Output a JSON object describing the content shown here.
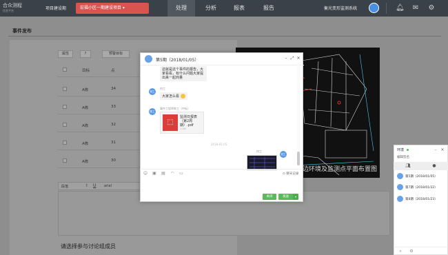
{
  "app": {
    "logo_text": "合众测程",
    "logo_sub": "信息平台"
  },
  "header": {
    "project_label": "项目建设期",
    "project_select": "宏福小区一期建设项目",
    "tabs": [
      {
        "label": "处理",
        "active": true
      },
      {
        "label": "分析",
        "active": false
      },
      {
        "label": "报表",
        "active": false
      },
      {
        "label": "报告",
        "active": false
      }
    ],
    "user_name": "衡光变形监测系统"
  },
  "page": {
    "title": "事件发布",
    "table_head": {
      "btn1": "属性",
      "btn2": "?",
      "btn3": "预警目标"
    },
    "rows": [
      {
        "target": "A栋",
        "value": "34"
      },
      {
        "target": "A栋",
        "value": "33"
      },
      {
        "target": "A栋",
        "value": "32"
      },
      {
        "target": "A栋",
        "value": "31"
      },
      {
        "target": "A栋",
        "value": "30"
      }
    ],
    "col_target": "目标",
    "col_point": "点",
    "editor": {
      "format": "段落",
      "font": "arial"
    },
    "members_label": "请选择参与讨论组成员",
    "cad_caption": "周边环境及监测点平面布置图"
  },
  "modal": {
    "title": "第5期（2018/01/05）",
    "messages": [
      {
        "type": "text",
        "text": "这就是这个事件的报告，大家看看，有什么问题大家提出来一起商量"
      },
      {
        "type": "text",
        "avatar": "何工",
        "sender": "何工",
        "text": "大家怎么看"
      },
      {
        "type": "file",
        "avatar": "陈工",
        "sender": "事件工程师陈工（中标）",
        "filename": "监测日报表（第2周期）.pdf",
        "size": "1.0M"
      },
      {
        "type": "time",
        "text": "2018-01-05"
      },
      {
        "type": "image",
        "avatar": "何工",
        "sender": "何工"
      }
    ],
    "history_link": "聊天记录",
    "btn_close": "关闭",
    "btn_send": "发送"
  },
  "side": {
    "title": "环境",
    "subtitle": "编辑签名",
    "groups": [
      {
        "name": "第5期（2018/01/05）"
      },
      {
        "name": "第7期（2018/01/22）"
      },
      {
        "name": "第8期（2018/01/23）"
      }
    ]
  }
}
